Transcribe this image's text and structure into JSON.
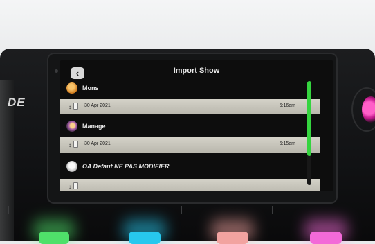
{
  "screen": {
    "title": "Import Show",
    "back_icon": "chevron-left-icon",
    "shows": [
      {
        "name": "Mons",
        "avatar_color": "#e08a2a",
        "date": "30 Apr 2021",
        "time": "6:16am"
      },
      {
        "name": "Manage",
        "avatar_color": "#f0a24a",
        "date": "30 Apr 2021",
        "time": "6:15am"
      },
      {
        "name": "OA Defaut NE PAS MODIFIER",
        "avatar_color": "#e3e3e3",
        "date": "",
        "time": ""
      }
    ],
    "scroll_fraction": 0.72,
    "scroll_color": "#35d43f"
  },
  "device": {
    "brand": "DE",
    "pad_colors": [
      "#4fe06a",
      "#27c8ee",
      "#f2a3a0",
      "#f36ad8"
    ],
    "knob_color": "#e0289f"
  }
}
